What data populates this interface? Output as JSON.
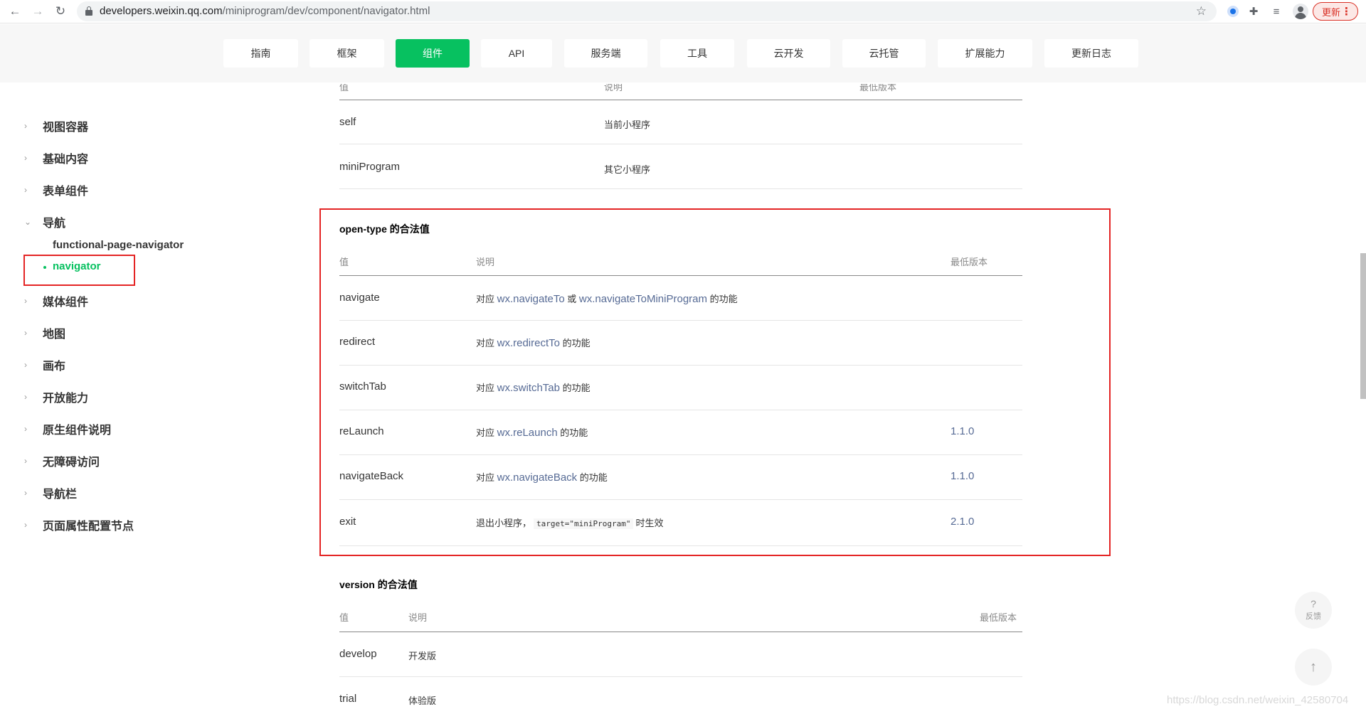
{
  "browser": {
    "url_host": "developers.weixin.qq.com",
    "url_path": "/miniprogram/dev/component/navigator.html",
    "update_label": "更新",
    "icons": [
      "back-icon",
      "forward-icon",
      "reload-icon",
      "lock-icon",
      "star-icon",
      "extension-icon",
      "puzzle-icon",
      "reading-list-icon",
      "profile-icon",
      "more-icon"
    ]
  },
  "topnav": {
    "tabs": [
      {
        "label": "指南"
      },
      {
        "label": "框架"
      },
      {
        "label": "组件",
        "active": true
      },
      {
        "label": "API"
      },
      {
        "label": "服务端"
      },
      {
        "label": "工具"
      },
      {
        "label": "云开发"
      },
      {
        "label": "云托管"
      },
      {
        "label": "扩展能力"
      },
      {
        "label": "更新日志"
      }
    ]
  },
  "sidebar": {
    "items": [
      {
        "label": "视图容器"
      },
      {
        "label": "基础内容"
      },
      {
        "label": "表单组件"
      },
      {
        "label": "导航",
        "expanded": true
      },
      {
        "label": "媒体组件"
      },
      {
        "label": "地图"
      },
      {
        "label": "画布"
      },
      {
        "label": "开放能力"
      },
      {
        "label": "原生组件说明"
      },
      {
        "label": "无障碍访问"
      },
      {
        "label": "导航栏"
      },
      {
        "label": "页面属性配置节点"
      }
    ],
    "sub_items": [
      {
        "label": "functional-page-navigator"
      },
      {
        "label": "navigator",
        "active": true
      }
    ]
  },
  "target_table": {
    "headers": [
      "值",
      "说明",
      "最低版本"
    ],
    "rows": [
      {
        "value": "self",
        "desc": "当前小程序"
      },
      {
        "value": "miniProgram",
        "desc": "其它小程序"
      }
    ]
  },
  "open_type": {
    "title": "open-type 的合法值",
    "headers": [
      "值",
      "说明",
      "最低版本"
    ],
    "rows": [
      {
        "value": "navigate",
        "pre": "对应 ",
        "link1": "wx.navigateTo",
        "mid": " 或 ",
        "link2": "wx.navigateToMiniProgram",
        "post": " 的功能",
        "version": ""
      },
      {
        "value": "redirect",
        "pre": "对应 ",
        "link1": "wx.redirectTo",
        "post": " 的功能",
        "version": ""
      },
      {
        "value": "switchTab",
        "pre": "对应 ",
        "link1": "wx.switchTab",
        "post": " 的功能",
        "version": ""
      },
      {
        "value": "reLaunch",
        "pre": "对应 ",
        "link1": "wx.reLaunch",
        "post": " 的功能",
        "version": "1.1.0"
      },
      {
        "value": "navigateBack",
        "pre": "对应 ",
        "link1": "wx.navigateBack",
        "post": " 的功能",
        "version": "1.1.0"
      },
      {
        "value": "exit",
        "pre": "退出小程序，",
        "code": "target=\"miniProgram\"",
        "post": "时生效",
        "version": "2.1.0"
      }
    ]
  },
  "version_table": {
    "title": "version 的合法值",
    "headers": [
      "值",
      "说明",
      "最低版本"
    ],
    "rows": [
      {
        "value": "develop",
        "desc": "开发版"
      },
      {
        "value": "trial",
        "desc": "体验版"
      }
    ]
  },
  "widgets": {
    "feedback_q": "?",
    "feedback_label": "反馈",
    "totop_icon": "↑"
  },
  "watermark": "https://blog.csdn.net/weixin_42580704",
  "colors": {
    "accent": "#07c160",
    "link": "#576b95",
    "highlight_box": "#e42424"
  }
}
